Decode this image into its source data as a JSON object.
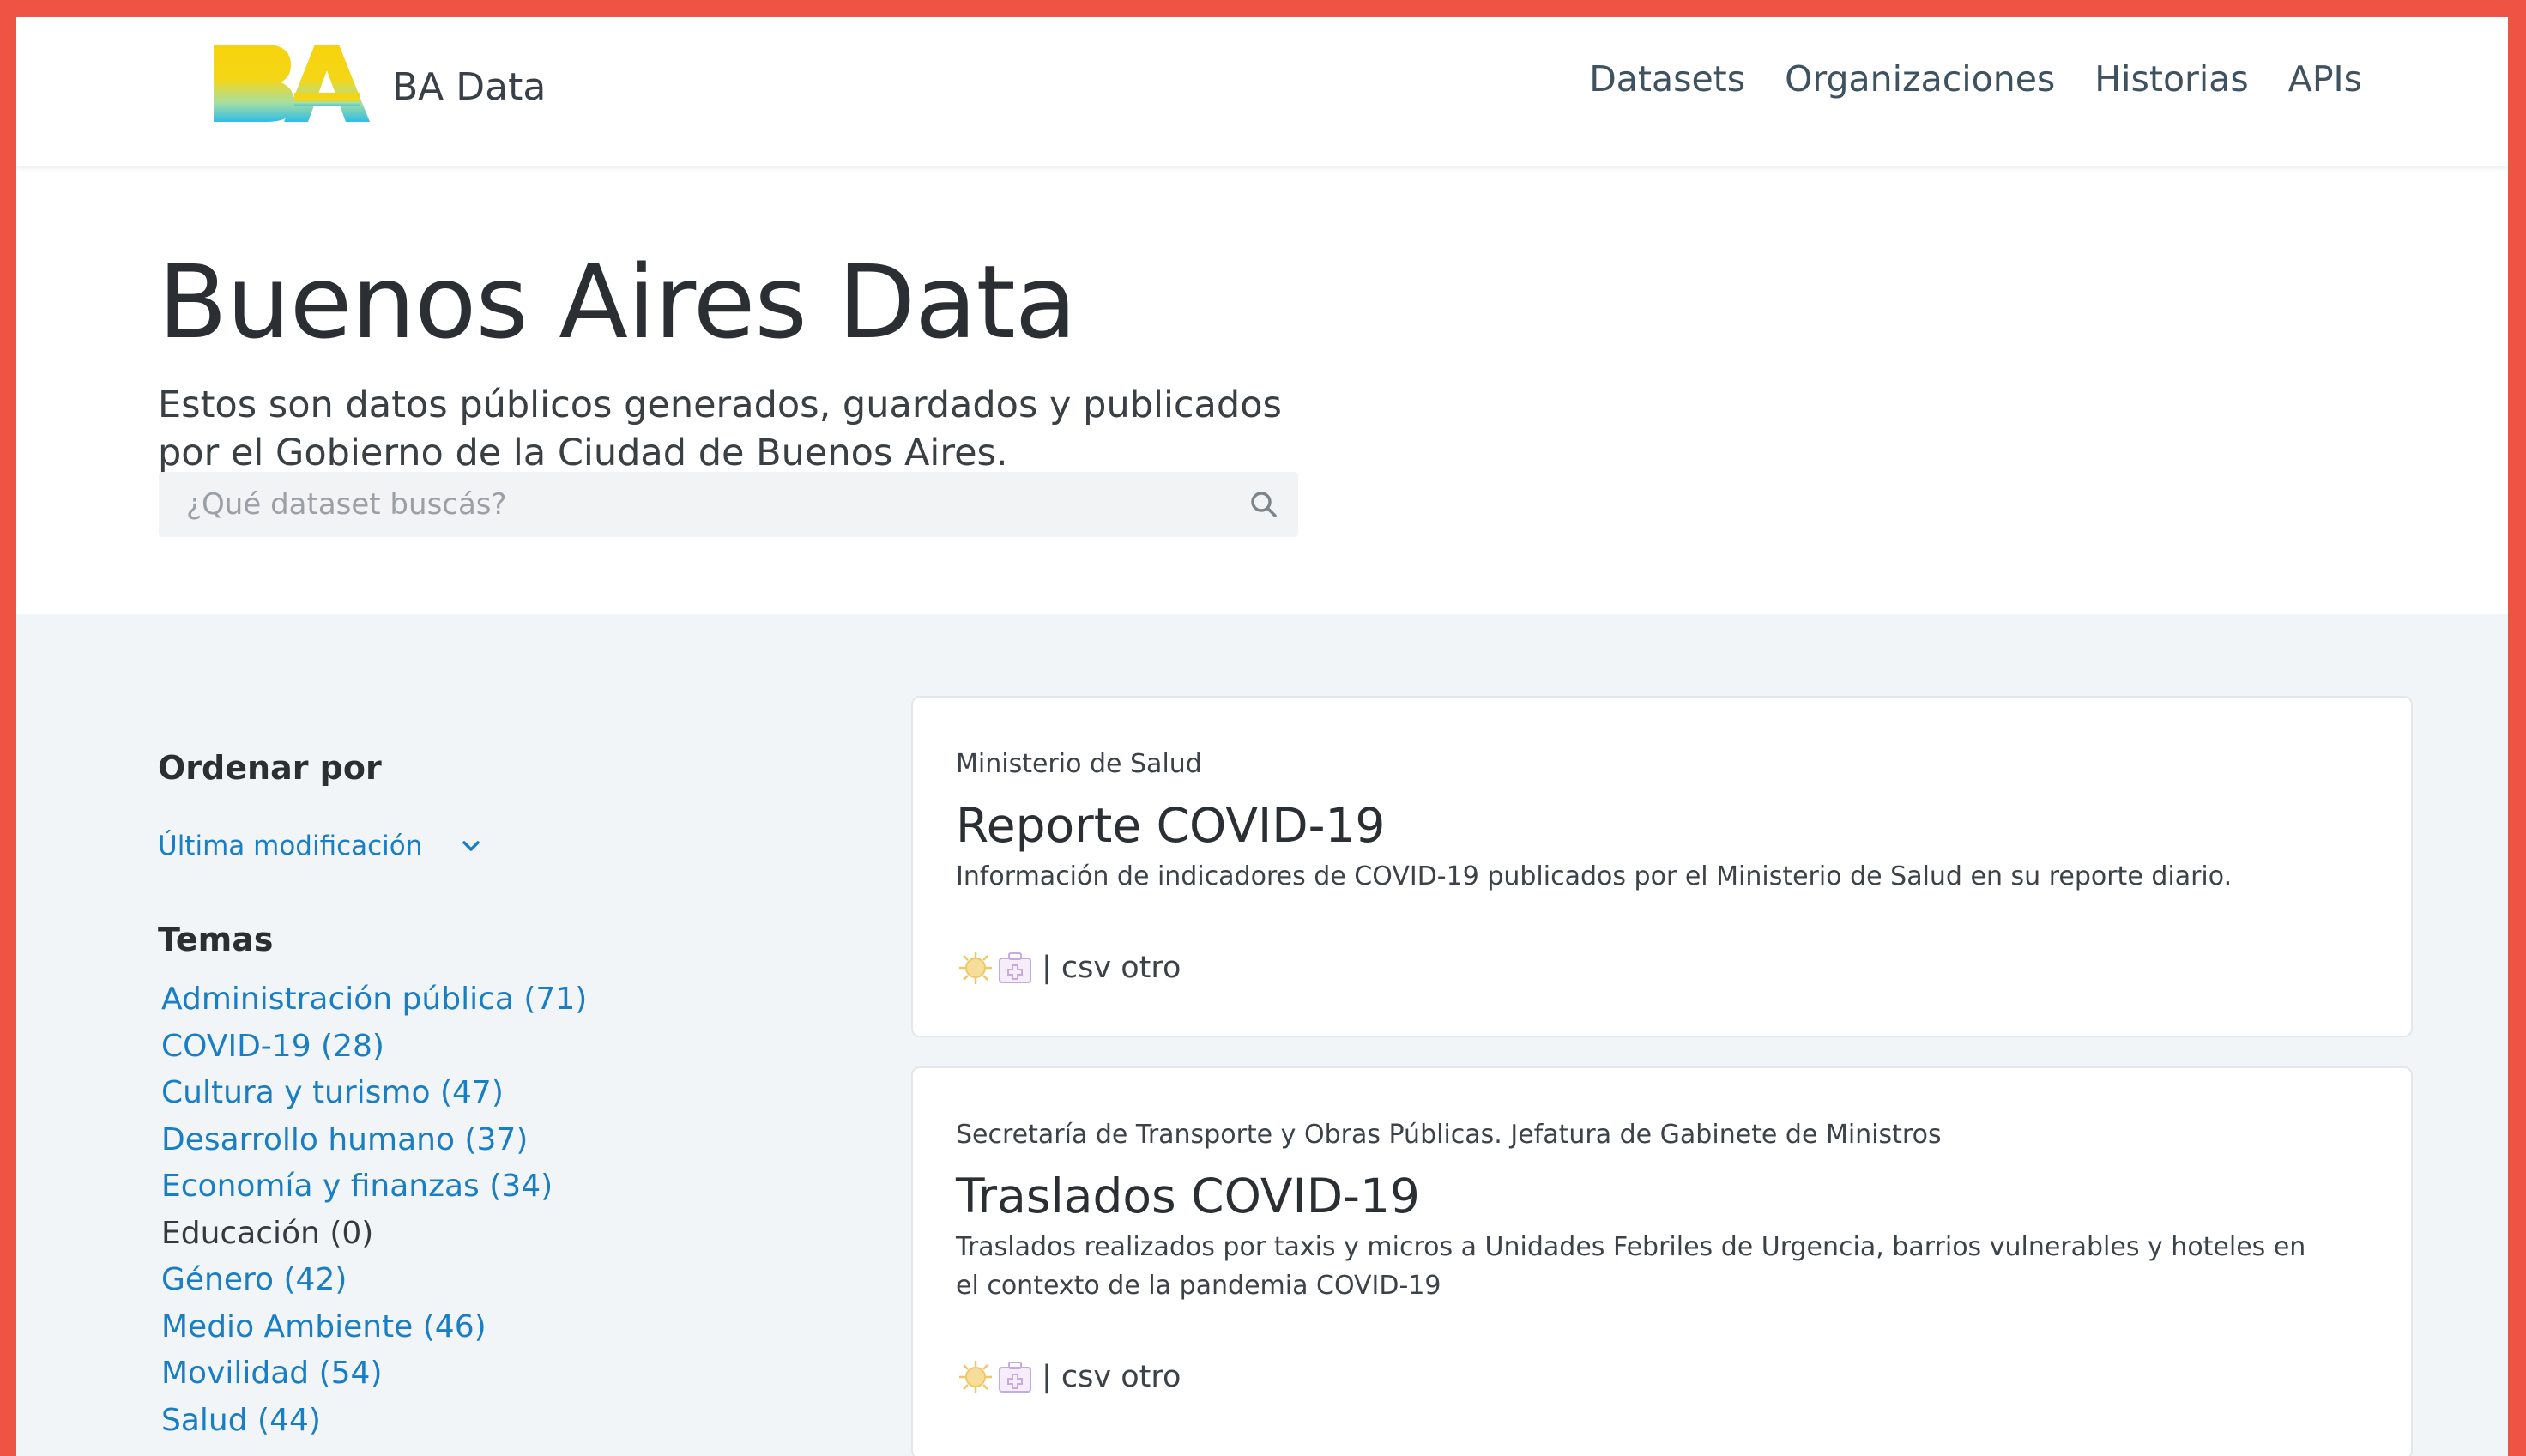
{
  "brand": {
    "name": "BA Data",
    "logo_icon": "ba-logo-icon"
  },
  "nav": {
    "items": [
      {
        "label": "Datasets"
      },
      {
        "label": "Organizaciones"
      },
      {
        "label": "Historias"
      },
      {
        "label": "APIs"
      }
    ]
  },
  "hero": {
    "title": "Buenos Aires Data",
    "subtitle": "Estos son datos públicos generados, guardados y publicados por el Gobierno de la Ciudad de Buenos Aires.",
    "search_placeholder": "¿Qué dataset buscás?",
    "search_value": ""
  },
  "sidebar": {
    "sort_title": "Ordenar por",
    "sort_selected": "Última modificación",
    "temas_title": "Temas",
    "temas": [
      {
        "label": "Administración pública (71)",
        "link": true
      },
      {
        "label": "COVID-19 (28)",
        "link": true
      },
      {
        "label": "Cultura y turismo (47)",
        "link": true
      },
      {
        "label": "Desarrollo humano (37)",
        "link": true
      },
      {
        "label": "Economía y finanzas (34)",
        "link": true
      },
      {
        "label": "Educación (0)",
        "link": false
      },
      {
        "label": "Género (42)",
        "link": true
      },
      {
        "label": "Medio Ambiente (46)",
        "link": true
      },
      {
        "label": "Movilidad (54)",
        "link": true
      },
      {
        "label": "Salud (44)",
        "link": true
      }
    ]
  },
  "datasets": [
    {
      "org": "Ministerio de Salud",
      "title": "Reporte COVID-19",
      "description": "Información de indicadores de COVID-19 publicados por el Ministerio de Salud en su reporte diario.",
      "formats": "| csv otro"
    },
    {
      "org": "Secretaría de Transporte y Obras Públicas. Jefatura de Gabinete de Ministros",
      "title": "Traslados COVID-19",
      "description": "Traslados realizados por taxis y micros a Unidades Febriles de Urgencia, barrios vulnerables y hoteles en el contexto de la pandemia COVID-19",
      "formats": "| csv otro"
    }
  ],
  "colors": {
    "frame": "#ee5344",
    "link": "#1a7ec4",
    "logo_yellow": "#f5d20a",
    "logo_blue": "#38c0e8"
  }
}
